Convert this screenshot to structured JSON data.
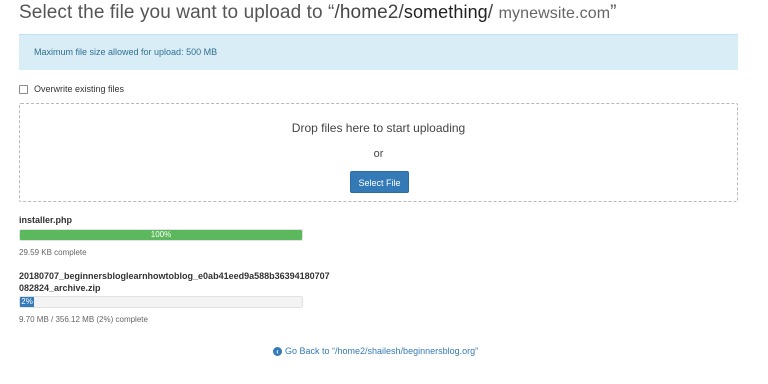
{
  "header": {
    "title_prefix": "Select the file you want to upload to “",
    "path_home": "/home2/",
    "path_something": "something",
    "path_slash": "/",
    "path_site": "mynewsite.com",
    "title_suffix": "”"
  },
  "info": {
    "max_size_text": "Maximum file size allowed for upload: 500 MB"
  },
  "options": {
    "overwrite_label": "Overwrite existing files",
    "overwrite_checked": false
  },
  "dropzone": {
    "drop_text": "Drop files here to start uploading",
    "or_text": "or",
    "select_button_label": "Select File"
  },
  "uploads": [
    {
      "name_line1": "installer.php",
      "name_line2": "",
      "progress_percent": 100,
      "progress_label": "100%",
      "status": "29.59 KB complete"
    },
    {
      "name_line1": "20180707_beginnersbloglearnhowtoblog_e0ab41eed9a588b36394180707",
      "name_line2": "082824_archive.zip",
      "progress_percent": 2,
      "progress_label": "2%",
      "status": "9.70 MB / 356.12 MB (2%) complete"
    }
  ],
  "footer": {
    "go_back_label": "Go Back to “/home2/shailesh/beginnersblog.org”",
    "go_back_icon": "circle-arrow-left-icon"
  },
  "colors": {
    "info_bg": "#d9edf7",
    "info_text": "#31708f",
    "button_blue": "#337ab7",
    "progress_green": "#5cb85c",
    "link_blue": "#337ab7"
  }
}
